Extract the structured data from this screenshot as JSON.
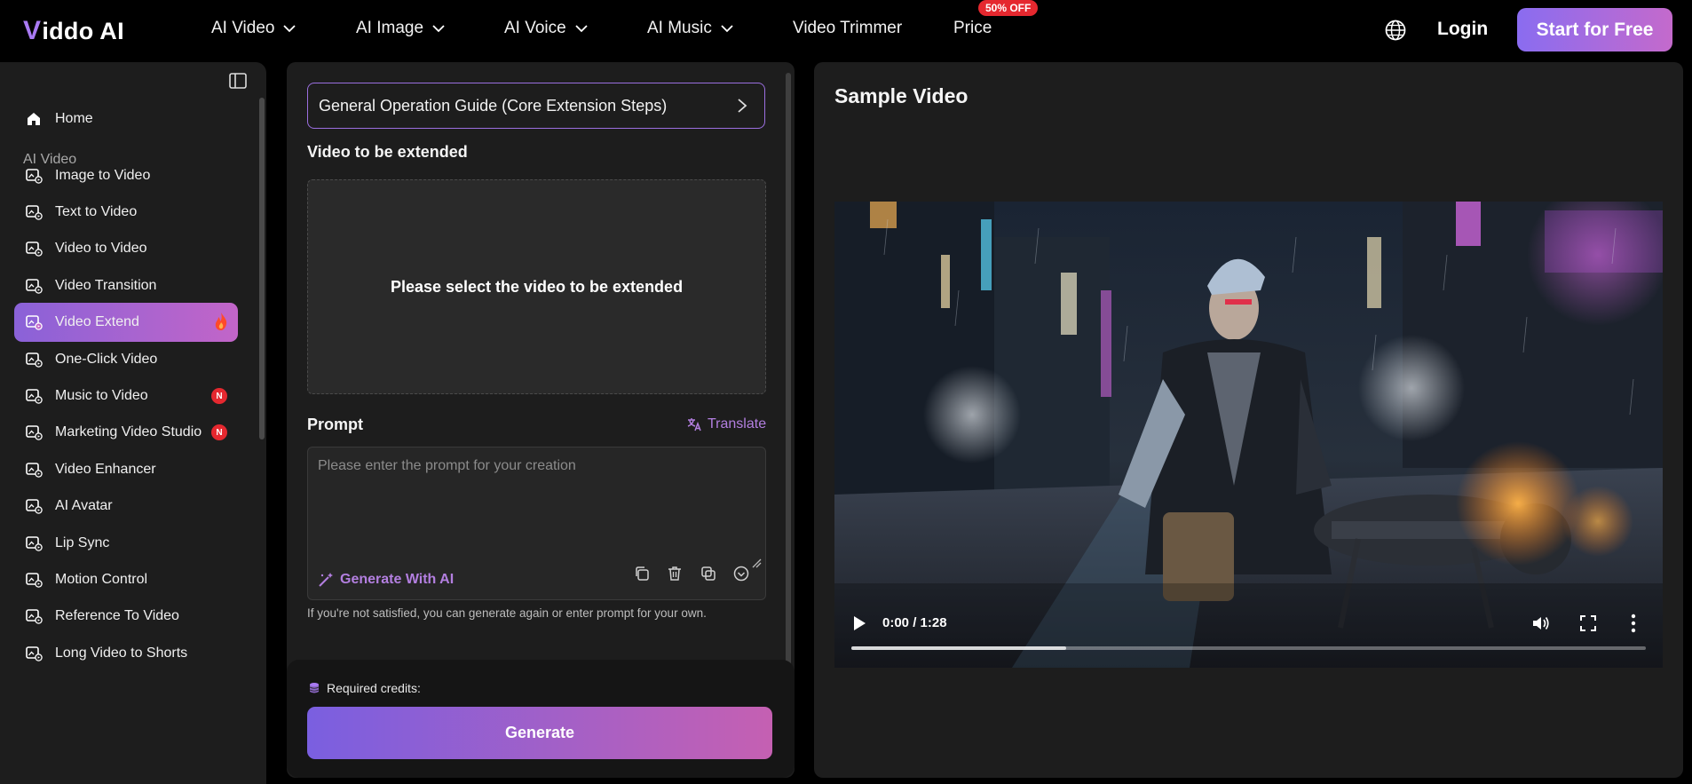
{
  "brand": {
    "logo_text": "iddo AI",
    "logo_mark": "V"
  },
  "topnav": {
    "items": [
      {
        "label": "AI Video",
        "dropdown": true
      },
      {
        "label": "AI Image",
        "dropdown": true
      },
      {
        "label": "AI Voice",
        "dropdown": true
      },
      {
        "label": "AI Music",
        "dropdown": true
      },
      {
        "label": "Video Trimmer",
        "dropdown": false
      },
      {
        "label": "Price",
        "dropdown": false
      }
    ],
    "price_badge": "50% OFF",
    "login_label": "Login",
    "start_label": "Start for Free",
    "language_icon": "globe-icon"
  },
  "sidebar": {
    "home_label": "Home",
    "section_label": "AI Video",
    "items": [
      {
        "label": "Image to Video",
        "icon": "image-video-icon"
      },
      {
        "label": "Text to Video",
        "icon": "text-video-icon"
      },
      {
        "label": "Video to Video",
        "icon": "video-video-icon"
      },
      {
        "label": "Video Transition",
        "icon": "transition-icon"
      },
      {
        "label": "Video Extend",
        "icon": "extend-icon",
        "active": true,
        "badge": "fire"
      },
      {
        "label": "One-Click Video",
        "icon": "one-click-icon"
      },
      {
        "label": "Music to Video",
        "icon": "music-video-icon",
        "badge": "N"
      },
      {
        "label": "Marketing Video Studio",
        "icon": "marketing-icon",
        "badge": "N"
      },
      {
        "label": "Video Enhancer",
        "icon": "enhancer-icon"
      },
      {
        "label": "AI Avatar",
        "icon": "avatar-icon"
      },
      {
        "label": "Lip Sync",
        "icon": "lip-sync-icon"
      },
      {
        "label": "Motion Control",
        "icon": "motion-icon"
      },
      {
        "label": "Reference To Video",
        "icon": "reference-icon"
      },
      {
        "label": "Long Video to Shorts",
        "icon": "shorts-icon"
      }
    ]
  },
  "editor": {
    "guide_label": "General Operation Guide (Core Extension Steps)",
    "video_section_title": "Video to be extended",
    "upload_prompt": "Please select the video to be extended",
    "prompt_title": "Prompt",
    "translate_label": "Translate",
    "prompt_placeholder": "Please enter the prompt for your creation",
    "prompt_value": "",
    "generate_ai_label": "Generate With AI",
    "hint": "If you're not satisfied, you can generate again or enter prompt for your own.",
    "credits_label": "Required credits:",
    "generate_label": "Generate"
  },
  "preview": {
    "title": "Sample Video",
    "time": "0:00 / 1:28",
    "progress": 0.27
  },
  "colors": {
    "accent_start": "#8a6cf0",
    "accent_end": "#c46acc",
    "badge_red": "#e5282f",
    "panel": "#1d1d1d"
  }
}
